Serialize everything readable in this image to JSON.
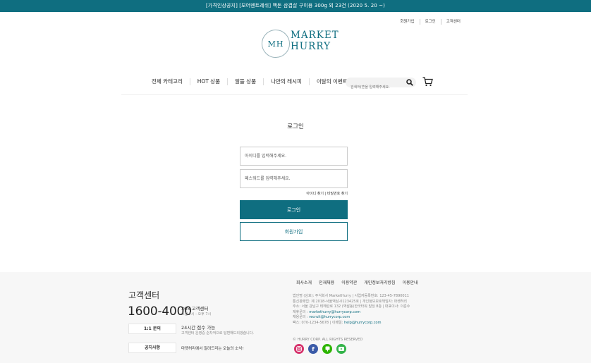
{
  "notice": {
    "text": "[가격인상공지] [모어멘트레쉬] 백돈 삼겹살 구이용 300g 외 23건 (2020 5. 20 ~)"
  },
  "utility": [
    "회원가입",
    "로그인",
    "고객센터"
  ],
  "logo": {
    "mark": "MH",
    "line1": "MARKET",
    "line2": "HURRY"
  },
  "nav": [
    "전체 카테고리",
    "HOT 상품",
    "알뜰 상품",
    "나만의 레시피",
    "이달의 이벤트"
  ],
  "search": {
    "placeholder": "검색어(흔을 입력해주세요."
  },
  "login": {
    "title": "로그인",
    "id_placeholder": "아이디를 입력해주세요.",
    "pw_placeholder": "패스워드를 입력해주세요.",
    "find_links": "아이디 찾기 | 비밀번호 찾기",
    "login_button": "로그인",
    "join_button": "회원가입"
  },
  "footer": {
    "cs_title": "고객센터",
    "phone": "1600-4000",
    "hours_title": "365 고객센터",
    "hours_sub": "오전 7시 - 오후 7시",
    "inquiry_button": "1:1 문의",
    "inquiry_title": "24시간 접수 가능",
    "inquiry_sub": "고객센터 운영중 순차적으로 답변해드리겠습니다.",
    "notice_button": "공지사항",
    "notice_text": "마켓허리에서 알려드리는 오늘의 소식!",
    "links": [
      "회사소개",
      "인재채용",
      "이용약관",
      "개인정보처리방침",
      "이용안내"
    ],
    "info_lines": [
      "법인명 (상호): 주식회사 MarketHurry  |  사업자등록번호: 123-45-7890011",
      "통신판매업: 제 2018-서울역삼-0123425호  |  개인정보보호책임자: 마켓허리",
      "주소: 서울 강남구 테헤란로 132 (역삼동)한국타워 빌딩 8층  |  대표이사: 이준수"
    ],
    "contact1_label": "제휴문의 : ",
    "contact1_value": "markethurry@hurrycorp.com",
    "contact2_label": "채용문의 : ",
    "contact2_value": "recruit@hurrycorp.com",
    "contact3_label": "팩스: 070-1234-5678  |  이메일: ",
    "contact3_value": "help@hurrycorp.com",
    "copyright": "© HURRY CORP. ALL RIGHTS RESERVED",
    "social": [
      "instagram-icon",
      "facebook-icon",
      "blog-icon",
      "youtube-icon"
    ]
  },
  "colors": {
    "brand": "#0f6e80"
  }
}
